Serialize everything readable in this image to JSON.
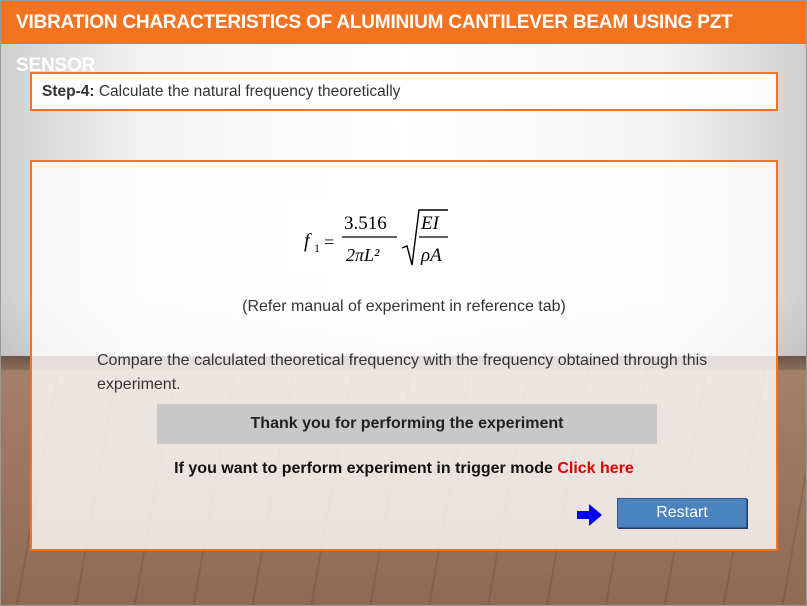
{
  "header": {
    "title": "VIBRATION CHARACTERISTICS OF ALUMINIUM CANTILEVER BEAM USING PZT SENSOR"
  },
  "step": {
    "label": "Step-4:",
    "text": " Calculate the natural frequency theoretically"
  },
  "formula": {
    "lhs": "f",
    "lhs_sub": "1",
    "coefficient": "3.516",
    "denominator": "2πL²",
    "root_numerator": "EI",
    "root_denominator": "ρA"
  },
  "refer_note": "(Refer manual of experiment in reference tab)",
  "compare_text": "Compare the calculated theoretical frequency with the frequency obtained through this experiment.",
  "thanks_text": "Thank you for performing the experiment",
  "trigger": {
    "text": "If you want to perform experiment in trigger mode ",
    "link": "Click here"
  },
  "restart_label": "Restart",
  "colors": {
    "accent": "#f47321",
    "button": "#4a83bf",
    "link": "#e00000",
    "arrow": "#0000ff"
  }
}
